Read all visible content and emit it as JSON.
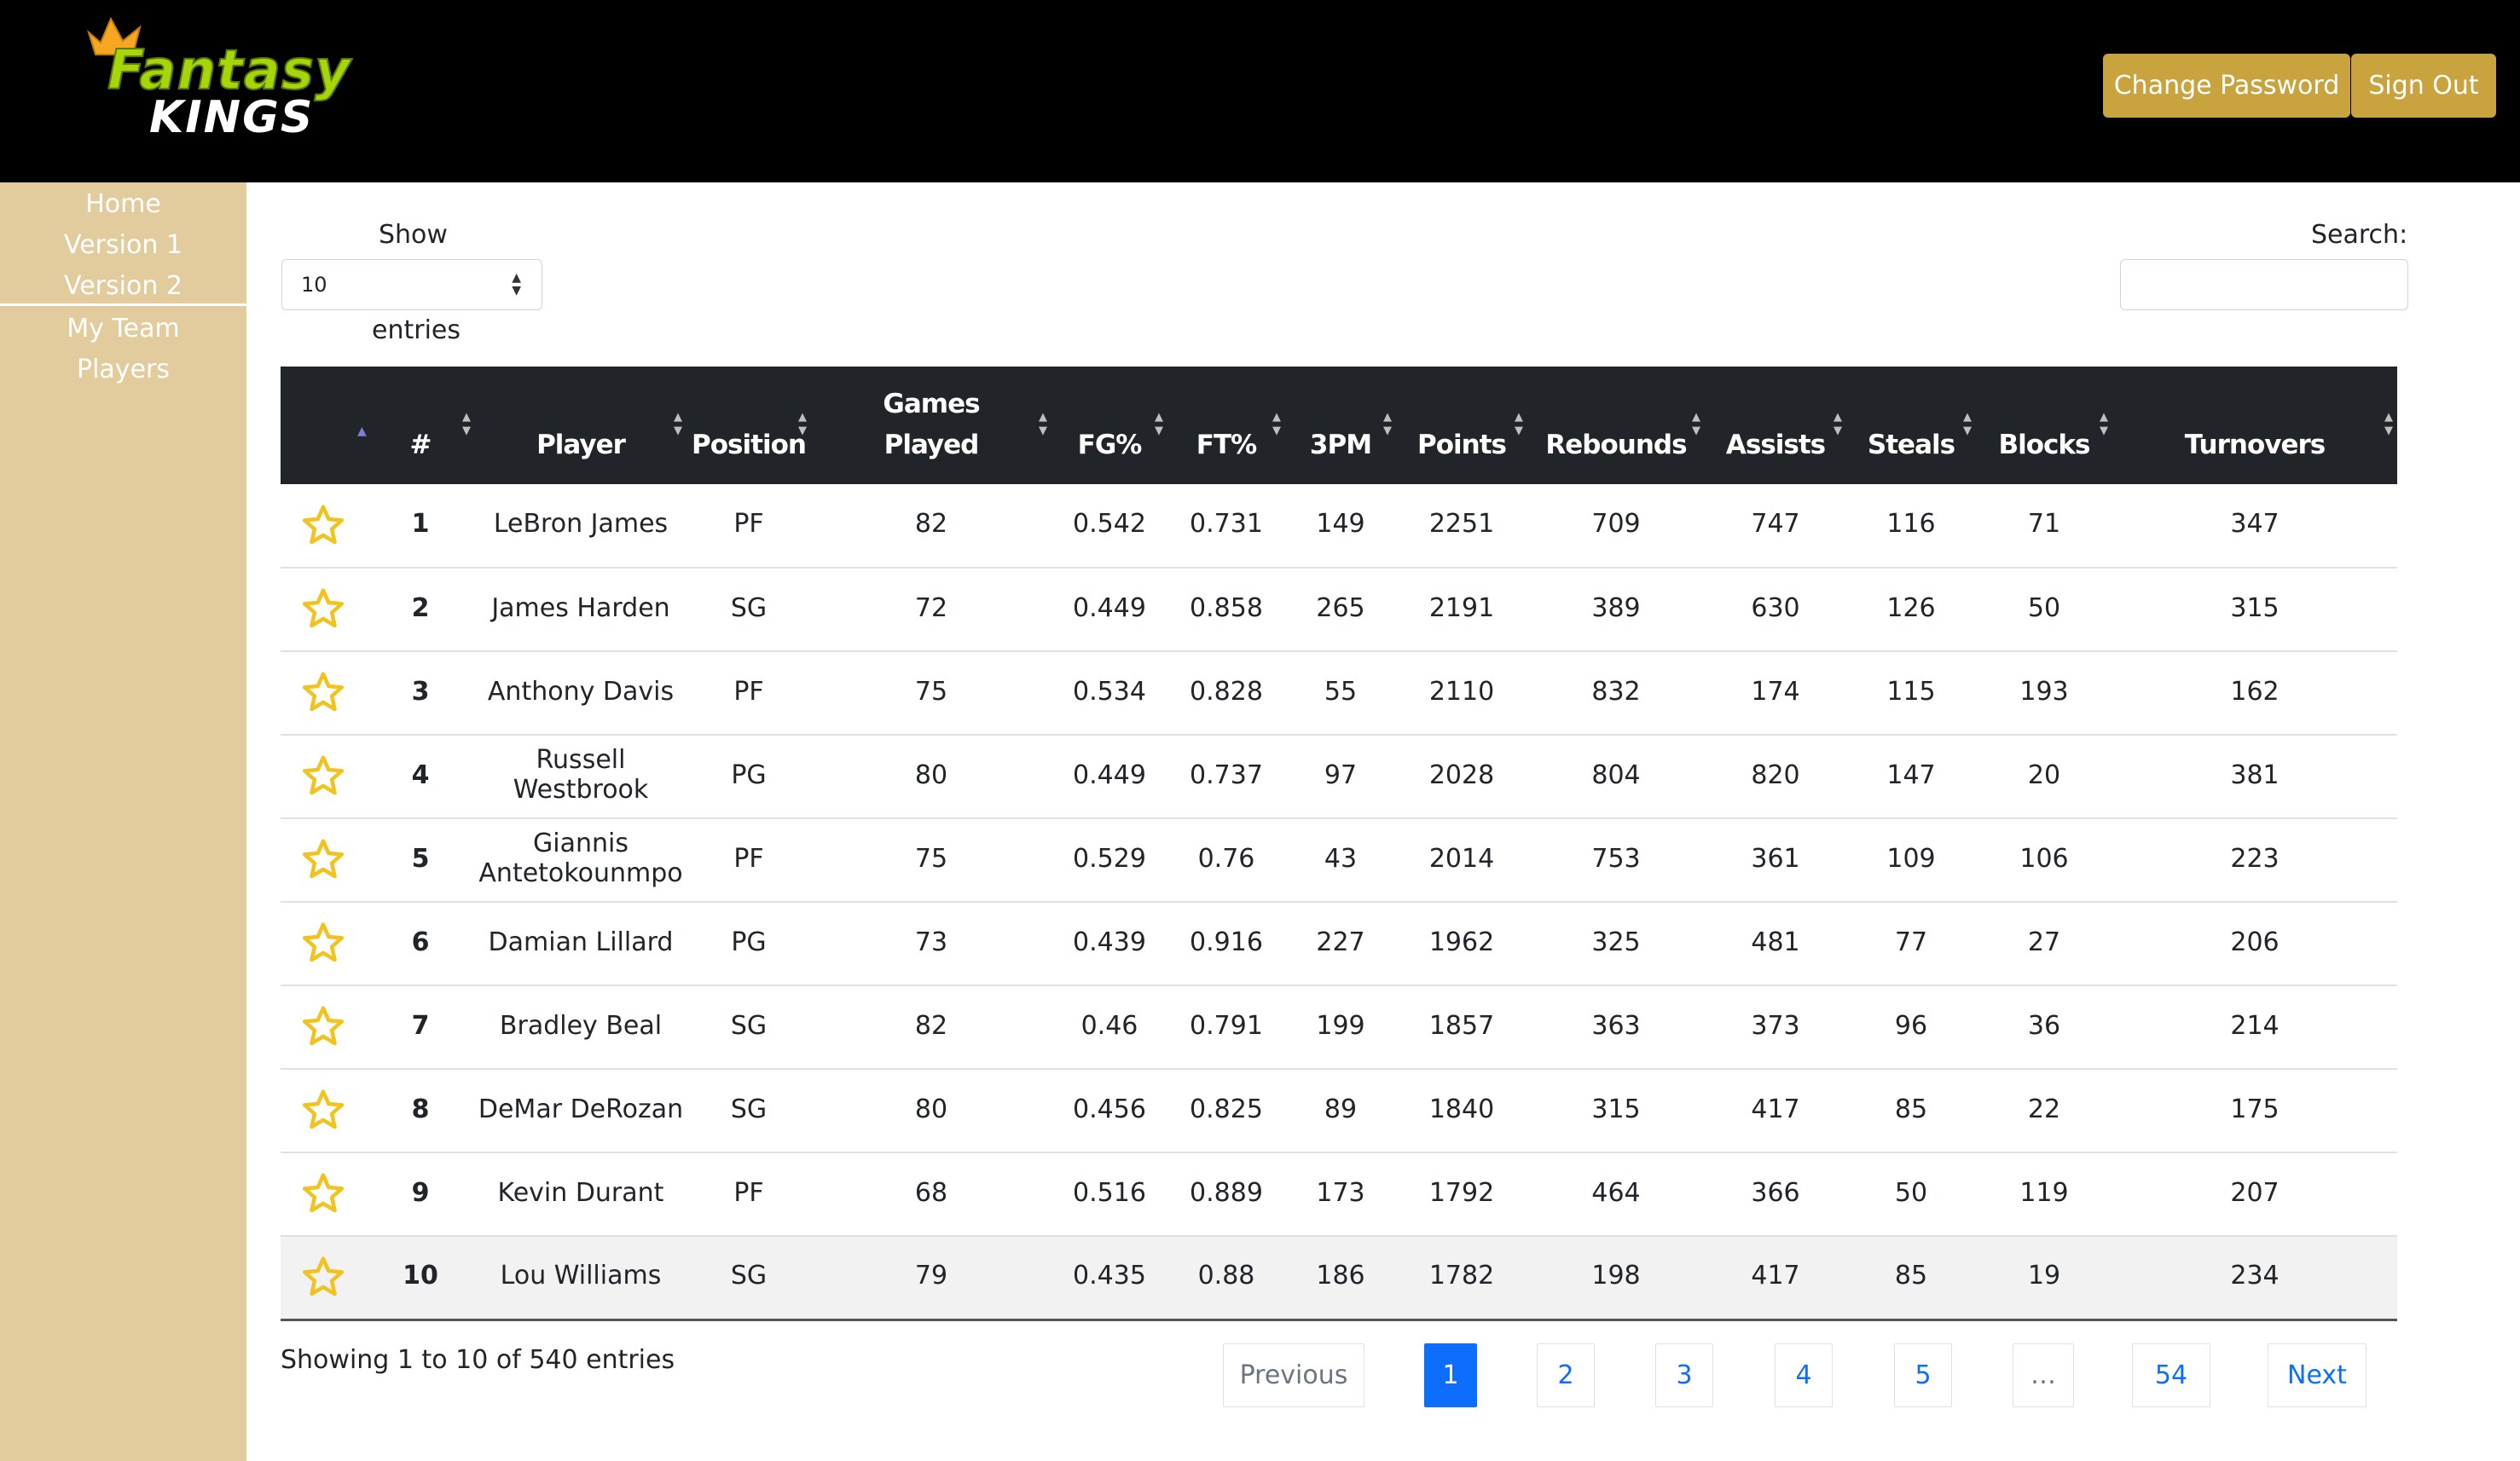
{
  "brand": {
    "logo_text_top": "Fantasy",
    "logo_text_bottom": "KINGS"
  },
  "header": {
    "change_password": "Change Password",
    "sign_out": "Sign Out"
  },
  "sidebar": {
    "items": [
      "Home",
      "Version 1",
      "Version 2",
      "My Team",
      "Players"
    ]
  },
  "controls": {
    "show_label": "Show",
    "entries_value": "10",
    "entries_label": "entries",
    "search_label": "Search:",
    "search_value": ""
  },
  "table": {
    "columns": [
      "#",
      "Player",
      "Position",
      "Games Played",
      "FG%",
      "FT%",
      "3PM",
      "Points",
      "Rebounds",
      "Assists",
      "Steals",
      "Blocks",
      "Turnovers"
    ],
    "rows": [
      [
        "1",
        "LeBron James",
        "PF",
        "82",
        "0.542",
        "0.731",
        "149",
        "2251",
        "709",
        "747",
        "116",
        "71",
        "347"
      ],
      [
        "2",
        "James Harden",
        "SG",
        "72",
        "0.449",
        "0.858",
        "265",
        "2191",
        "389",
        "630",
        "126",
        "50",
        "315"
      ],
      [
        "3",
        "Anthony Davis",
        "PF",
        "75",
        "0.534",
        "0.828",
        "55",
        "2110",
        "832",
        "174",
        "115",
        "193",
        "162"
      ],
      [
        "4",
        "Russell Westbrook",
        "PG",
        "80",
        "0.449",
        "0.737",
        "97",
        "2028",
        "804",
        "820",
        "147",
        "20",
        "381"
      ],
      [
        "5",
        "Giannis Antetokounmpo",
        "PF",
        "75",
        "0.529",
        "0.76",
        "43",
        "2014",
        "753",
        "361",
        "109",
        "106",
        "223"
      ],
      [
        "6",
        "Damian Lillard",
        "PG",
        "73",
        "0.439",
        "0.916",
        "227",
        "1962",
        "325",
        "481",
        "77",
        "27",
        "206"
      ],
      [
        "7",
        "Bradley Beal",
        "SG",
        "82",
        "0.46",
        "0.791",
        "199",
        "1857",
        "363",
        "373",
        "96",
        "36",
        "214"
      ],
      [
        "8",
        "DeMar DeRozan",
        "SG",
        "80",
        "0.456",
        "0.825",
        "89",
        "1840",
        "315",
        "417",
        "85",
        "22",
        "175"
      ],
      [
        "9",
        "Kevin Durant",
        "PF",
        "68",
        "0.516",
        "0.889",
        "173",
        "1792",
        "464",
        "366",
        "50",
        "119",
        "207"
      ],
      [
        "10",
        "Lou Williams",
        "SG",
        "79",
        "0.435",
        "0.88",
        "186",
        "1782",
        "198",
        "417",
        "85",
        "19",
        "234"
      ]
    ]
  },
  "footer": {
    "info": "Showing 1 to 10 of 540 entries",
    "previous": "Previous",
    "pages": [
      "1",
      "2",
      "3",
      "4",
      "5",
      "…",
      "54"
    ],
    "next": "Next",
    "active_page": "1"
  },
  "colors": {
    "header_bg": "#000000",
    "sidebar_bg": "#e2cb9c",
    "gold_button": "#c8a33e",
    "table_header": "#212529",
    "star": "#f2c21d",
    "link": "#0d6efd"
  },
  "icons": {
    "favorite": "star-outline-icon",
    "sort": "sort-arrows-icon",
    "select": "select-arrows-icon"
  }
}
